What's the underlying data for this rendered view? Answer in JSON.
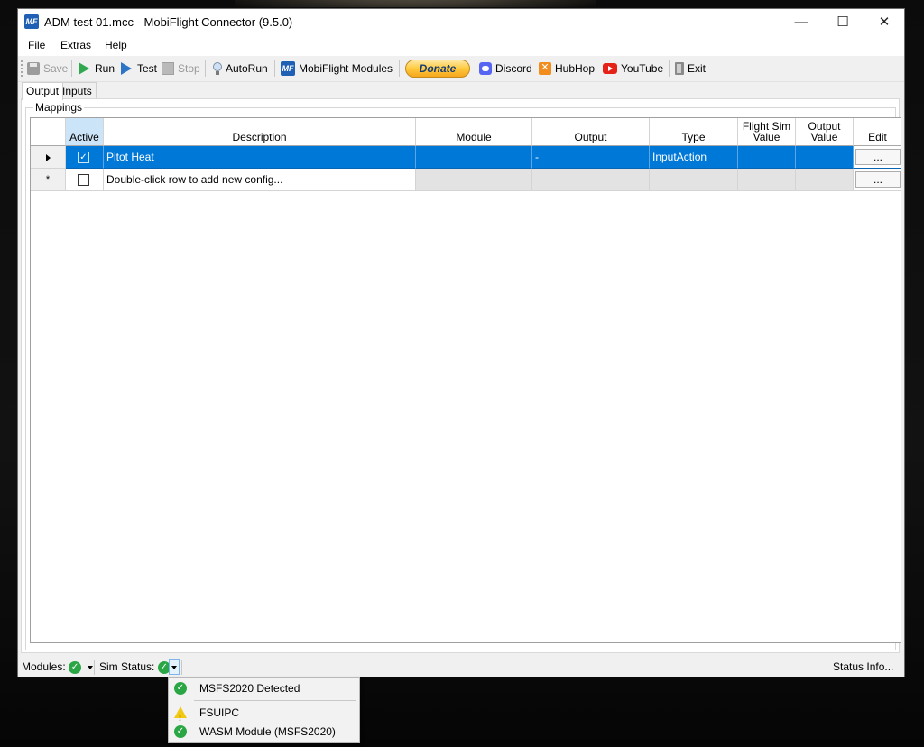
{
  "window": {
    "title": "ADM test 01.mcc - MobiFlight Connector (9.5.0)",
    "app_icon_text": "MF",
    "minimize": "—",
    "maximize": "☐",
    "close": "✕"
  },
  "menu": {
    "file": "File",
    "extras": "Extras",
    "help": "Help"
  },
  "toolbar": {
    "save": "Save",
    "run": "Run",
    "test": "Test",
    "stop": "Stop",
    "autorun": "AutoRun",
    "modules_icon_text": "MF",
    "modules": "MobiFlight Modules",
    "donate": "Donate",
    "discord": "Discord",
    "hubhop": "HubHop",
    "youtube": "YouTube",
    "exit": "Exit"
  },
  "tabs": {
    "output": "Output",
    "inputs": "Inputs"
  },
  "group_label": "Mappings",
  "grid": {
    "columns": {
      "active": "Active",
      "description": "Description",
      "module": "Module",
      "output": "Output",
      "type": "Type",
      "flight_sim_value_1": "Flight Sim",
      "flight_sim_value_2": "Value",
      "output_value_1": "Output",
      "output_value_2": "Value",
      "edit": "Edit"
    },
    "rows": [
      {
        "active": true,
        "description": "Pitot Heat",
        "module": "",
        "output": "-",
        "type": "InputAction",
        "flight_sim_value": "",
        "output_value": "",
        "edit": "..."
      },
      {
        "active": false,
        "description": "Double-click row to add new config...",
        "module": "",
        "output": "",
        "type": "",
        "flight_sim_value": "",
        "output_value": "",
        "edit": "...",
        "new_row_marker": "*"
      }
    ]
  },
  "statusbar": {
    "modules_label": "Modules:",
    "sim_status_label": "Sim Status:",
    "status_info": "Status Info...",
    "ok_glyph": "✓"
  },
  "sim_status_menu": {
    "items": [
      {
        "label": "MSFS2020 Detected",
        "status": "ok"
      },
      {
        "label": "FSUIPC",
        "status": "warning"
      },
      {
        "label": "WASM Module (MSFS2020)",
        "status": "ok"
      }
    ]
  },
  "colors": {
    "selection": "#0078d7",
    "ok_green": "#2aa744",
    "warning_yellow": "#f2c811",
    "donate_gold": "#ffc93c"
  }
}
